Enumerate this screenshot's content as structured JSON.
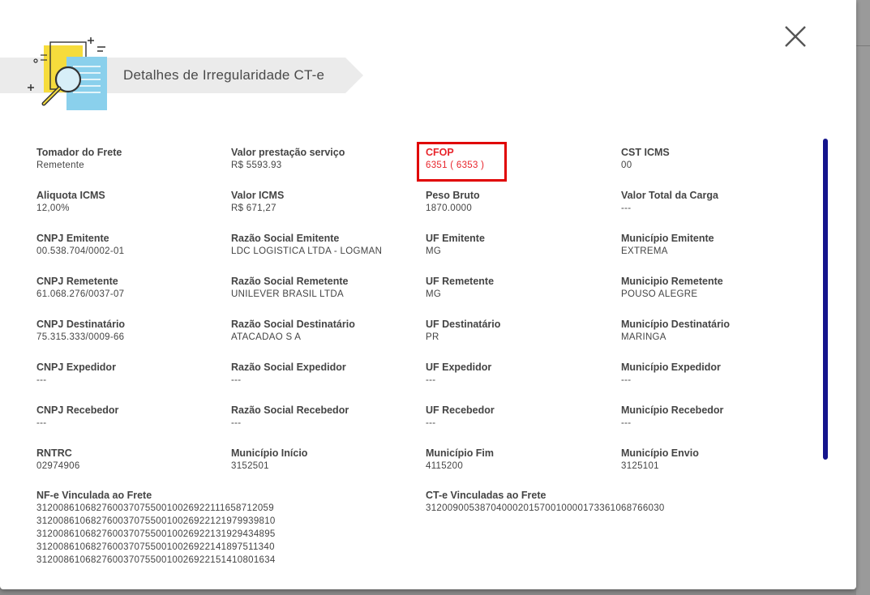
{
  "modal": {
    "title": "Detalhes de Irregularidade CT-e",
    "close_icon": "close-icon",
    "header_icon": "document-search-icon",
    "colors": {
      "accent_red": "#e8242b",
      "scrollbar": "#14148c",
      "header_band": "#ebebeb"
    }
  },
  "fields": [
    {
      "label": "Tomador do Frete",
      "value": "Remetente"
    },
    {
      "label": "Valor prestação serviço",
      "value": "R$ 5593.93"
    },
    {
      "label": "CFOP",
      "value": "6351 ( 6353 )"
    },
    {
      "label": "CST ICMS",
      "value": "00"
    },
    {
      "label": "Aliquota ICMS",
      "value": "12,00%"
    },
    {
      "label": "Valor ICMS",
      "value": "R$ 671,27"
    },
    {
      "label": "Peso Bruto",
      "value": "1870.0000"
    },
    {
      "label": "Valor Total da Carga",
      "value": "---"
    },
    {
      "label": "CNPJ Emitente",
      "value": "00.538.704/0002-01"
    },
    {
      "label": "Razão Social Emitente",
      "value": "LDC LOGISTICA LTDA - LOGMAN"
    },
    {
      "label": "UF Emitente",
      "value": "MG"
    },
    {
      "label": "Município Emitente",
      "value": "EXTREMA"
    },
    {
      "label": "CNPJ Remetente",
      "value": "61.068.276/0037-07"
    },
    {
      "label": "Razão Social Remetente",
      "value": "UNILEVER BRASIL LTDA"
    },
    {
      "label": "UF Remetente",
      "value": "MG"
    },
    {
      "label": "Municipio Remetente",
      "value": "POUSO ALEGRE"
    },
    {
      "label": "CNPJ Destinatário",
      "value": "75.315.333/0009-66"
    },
    {
      "label": "Razão Social Destinatário",
      "value": "ATACADAO S A"
    },
    {
      "label": "UF Destinatário",
      "value": "PR"
    },
    {
      "label": "Município Destinatário",
      "value": "MARINGA"
    },
    {
      "label": "CNPJ Expedidor",
      "value": "---"
    },
    {
      "label": "Razão Social Expedidor",
      "value": "---"
    },
    {
      "label": "UF Expedidor",
      "value": "---"
    },
    {
      "label": "Município Expedidor",
      "value": "---"
    },
    {
      "label": "CNPJ Recebedor",
      "value": "---"
    },
    {
      "label": "Razão Social Recebedor",
      "value": "---"
    },
    {
      "label": "UF Recebedor",
      "value": "---"
    },
    {
      "label": "Município Recebedor",
      "value": "---"
    },
    {
      "label": "RNTRC",
      "value": "02974906"
    },
    {
      "label": "Município Início",
      "value": "3152501"
    },
    {
      "label": "Município Fim",
      "value": "4115200"
    },
    {
      "label": "Município Envio",
      "value": "3125101"
    }
  ],
  "nfe": {
    "label": "NF-e Vinculada ao Frete",
    "values": [
      "31200861068276003707550010026922111658712059",
      "31200861068276003707550010026922121979939810",
      "31200861068276003707550010026922131929434895",
      "31200861068276003707550010026922141897511340",
      "31200861068276003707550010026922151410801634"
    ]
  },
  "cte": {
    "label": "CT-e Vinculadas ao Frete",
    "values": [
      "31200900538704000201570010000173361068766030"
    ]
  }
}
